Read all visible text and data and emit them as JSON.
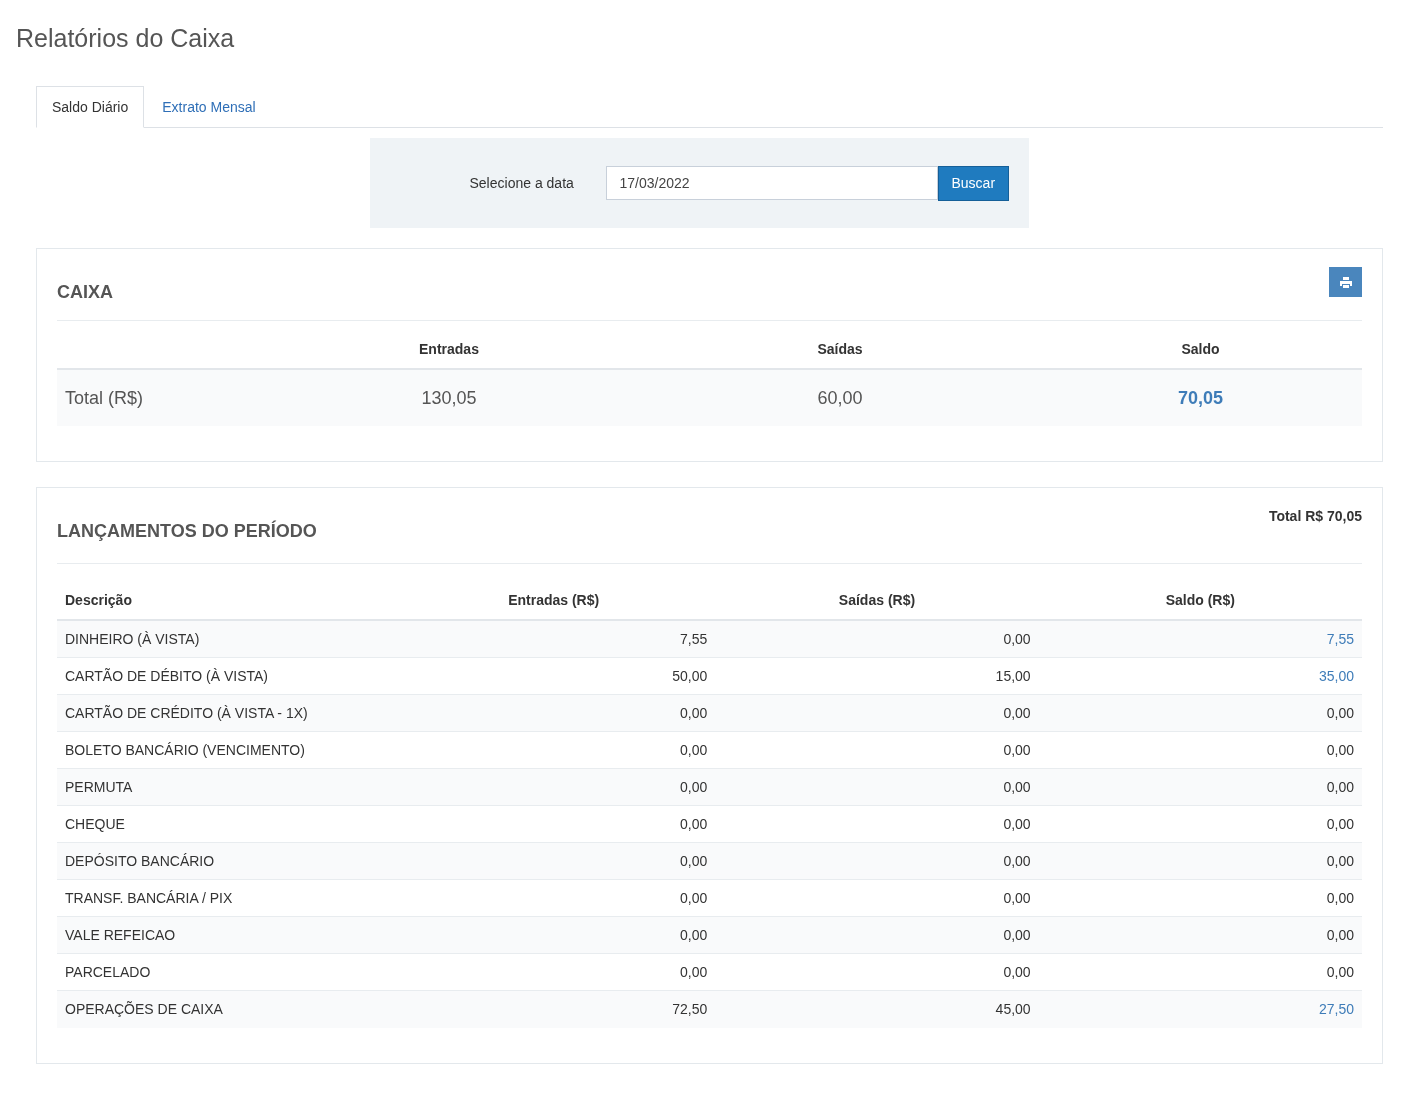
{
  "page_title": "Relatórios do Caixa",
  "tabs": [
    {
      "label": "Saldo Diário",
      "selected": true
    },
    {
      "label": "Extrato Mensal",
      "selected": false
    }
  ],
  "date_filter": {
    "label": "Selecione a data",
    "value": "17/03/2022",
    "button": "Buscar"
  },
  "caixa": {
    "title": "CAIXA",
    "columns": [
      "Entradas",
      "Saídas",
      "Saldo"
    ],
    "row": {
      "label": "Total (R$)",
      "entradas": "130,05",
      "saidas": "60,00",
      "saldo": "70,05"
    }
  },
  "lancamentos": {
    "title": "LANÇAMENTOS DO PERÍODO",
    "total": "Total R$ 70,05",
    "columns": [
      "Descrição",
      "Entradas (R$)",
      "Saídas (R$)",
      "Saldo (R$)"
    ],
    "rows": [
      {
        "descricao": "DINHEIRO (À VISTA)",
        "entradas": "7,55",
        "saidas": "0,00",
        "saldo": "7,55",
        "highlight": true
      },
      {
        "descricao": "CARTÃO DE DÉBITO (À VISTA)",
        "entradas": "50,00",
        "saidas": "15,00",
        "saldo": "35,00",
        "highlight": true
      },
      {
        "descricao": "CARTÃO DE CRÉDITO (À VISTA - 1X)",
        "entradas": "0,00",
        "saidas": "0,00",
        "saldo": "0,00",
        "highlight": false
      },
      {
        "descricao": "BOLETO BANCÁRIO (VENCIMENTO)",
        "entradas": "0,00",
        "saidas": "0,00",
        "saldo": "0,00",
        "highlight": false
      },
      {
        "descricao": "PERMUTA",
        "entradas": "0,00",
        "saidas": "0,00",
        "saldo": "0,00",
        "highlight": false
      },
      {
        "descricao": "CHEQUE",
        "entradas": "0,00",
        "saidas": "0,00",
        "saldo": "0,00",
        "highlight": false
      },
      {
        "descricao": "DEPÓSITO BANCÁRIO",
        "entradas": "0,00",
        "saidas": "0,00",
        "saldo": "0,00",
        "highlight": false
      },
      {
        "descricao": "TRANSF. BANCÁRIA / PIX",
        "entradas": "0,00",
        "saidas": "0,00",
        "saldo": "0,00",
        "highlight": false
      },
      {
        "descricao": "VALE REFEICAO",
        "entradas": "0,00",
        "saidas": "0,00",
        "saldo": "0,00",
        "highlight": false
      },
      {
        "descricao": "PARCELADO",
        "entradas": "0,00",
        "saidas": "0,00",
        "saldo": "0,00",
        "highlight": false
      },
      {
        "descricao": "OPERAÇÕES DE CAIXA",
        "entradas": "72,50",
        "saidas": "45,00",
        "saldo": "27,50",
        "highlight": true
      }
    ]
  }
}
